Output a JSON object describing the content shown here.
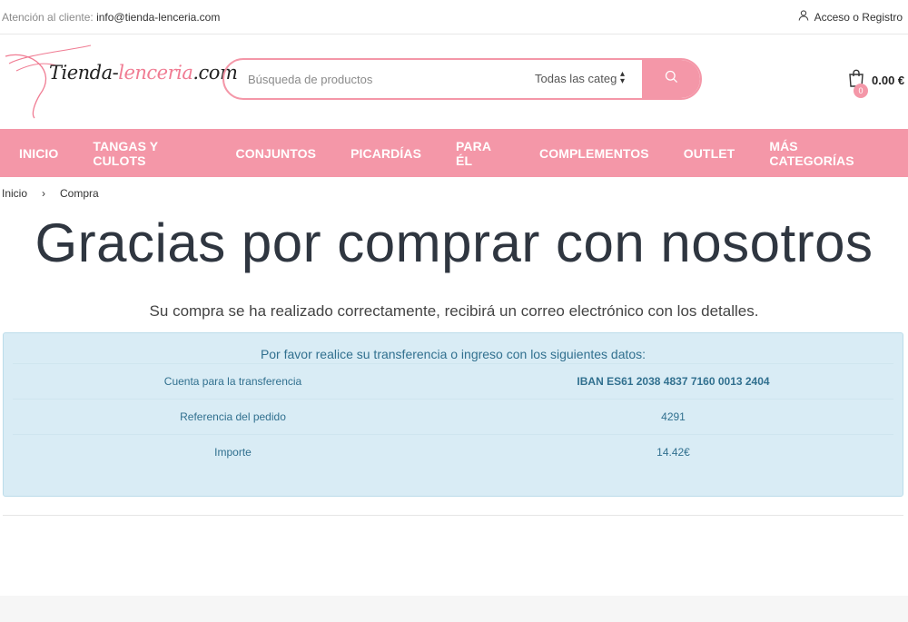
{
  "topbar": {
    "support_label": "Atención al cliente:",
    "support_email": "info@tienda-lenceria.com",
    "account_link": "Acceso o Registro"
  },
  "logo": {
    "text_a": "Tienda-",
    "text_b": "lenceria",
    "text_c": ".com"
  },
  "search": {
    "placeholder": "Búsqueda de productos",
    "category_selected": "Todas las categorías"
  },
  "cart": {
    "count": "0",
    "total": "0.00 €"
  },
  "nav": {
    "items": [
      "INICIO",
      "TANGAS Y CULOTS",
      "CONJUNTOS",
      "PICARDÍAS",
      "PARA ÉL",
      "COMPLEMENTOS",
      "OUTLET",
      "MÁS CATEGORÍAS"
    ]
  },
  "breadcrumb": {
    "home": "Inicio",
    "separator": "›",
    "current": "Compra"
  },
  "page": {
    "title": "Gracias por comprar con nosotros",
    "subtitle": "Su compra se ha realizado correctamente, recibirá un correo electrónico con los detalles."
  },
  "transfer": {
    "intro": "Por favor realice su transferencia o ingreso con los siguientes datos:",
    "rows": [
      {
        "label": "Cuenta para la transferencia",
        "value": "IBAN ES61 2038 4837 7160 0013 2404"
      },
      {
        "label": "Referencia del pedido",
        "value": "4291"
      },
      {
        "label": "Importe",
        "value": "14.42€"
      }
    ]
  },
  "colors": {
    "brand_pink": "#f497a8",
    "info_bg": "#d9ecf5",
    "info_text": "#31708f"
  },
  "icons": {
    "account": "user-icon",
    "search": "search-icon",
    "cart": "shopping-bag-icon",
    "select": "select-arrows-icon"
  }
}
